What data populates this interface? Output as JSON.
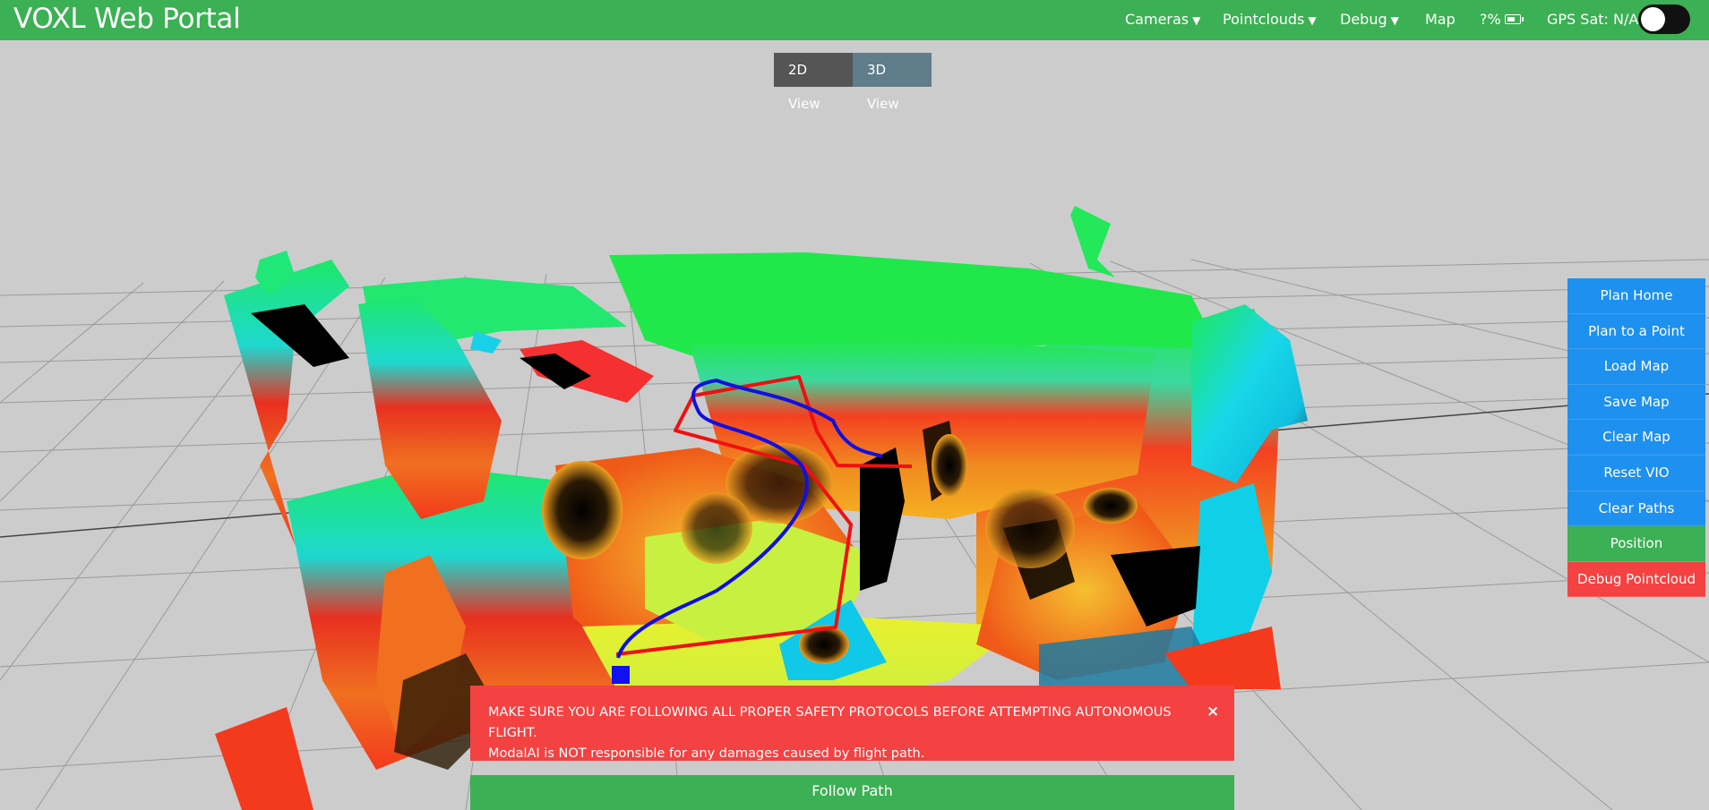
{
  "header": {
    "title": "VOXL Web Portal",
    "menu": [
      {
        "label": "Cameras",
        "caret": "▼"
      },
      {
        "label": "Pointclouds",
        "caret": "▼"
      },
      {
        "label": "Debug",
        "caret": "▼"
      },
      {
        "label": "Map"
      }
    ],
    "battery_text": "?%",
    "gps_text": "GPS Sat: N/A",
    "accent_color": "#3cb054"
  },
  "view_toggle": {
    "options": [
      "2D View",
      "3D View"
    ],
    "selected": "3D View"
  },
  "side_panel": {
    "buttons": [
      {
        "label": "Plan Home",
        "color": "#1e90ef"
      },
      {
        "label": "Plan to a Point",
        "color": "#1e90ef"
      },
      {
        "label": "Load Map",
        "color": "#1e90ef"
      },
      {
        "label": "Save Map",
        "color": "#1e90ef"
      },
      {
        "label": "Clear Map",
        "color": "#1e90ef"
      },
      {
        "label": "Reset VIO",
        "color": "#1e90ef"
      },
      {
        "label": "Clear Paths",
        "color": "#1e90ef"
      },
      {
        "label": "Position",
        "color": "#3cb054"
      },
      {
        "label": "Debug Pointcloud",
        "color": "#f44141"
      }
    ]
  },
  "alert": {
    "line1": "MAKE SURE YOU ARE FOLLOWING ALL PROPER SAFETY PROTOCOLS BEFORE ATTEMPTING AUTONOMOUS FLIGHT.",
    "line2": "ModalAI is NOT responsible for any damages caused by flight path.",
    "close_symbol": "×",
    "color": "#f44141"
  },
  "follow_button": {
    "label": "Follow Path"
  }
}
